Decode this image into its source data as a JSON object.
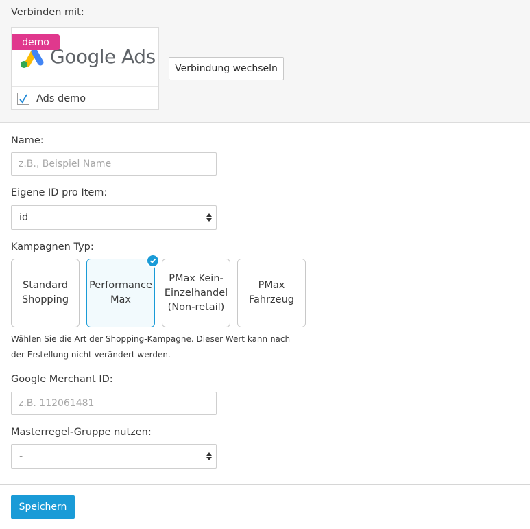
{
  "connect": {
    "label": "Verbinden mit:",
    "demo_badge": "demo",
    "provider_name": "Google Ads",
    "account_checked": true,
    "account_name": "Ads demo",
    "switch_button": "Verbindung wechseln"
  },
  "form": {
    "name": {
      "label": "Name:",
      "value": "",
      "placeholder": "z.B., Beispiel Name"
    },
    "item_id": {
      "label": "Eigene ID pro Item:",
      "value": "id"
    },
    "campaign_type": {
      "label": "Kampagnen Typ:",
      "options": [
        {
          "label": "Standard Shopping",
          "selected": false
        },
        {
          "label": "Performance Max",
          "selected": true
        },
        {
          "label": "PMax Kein-Einzelhandel (Non-retail)",
          "selected": false
        },
        {
          "label": "PMax Fahrzeug",
          "selected": false
        }
      ],
      "help": "Wählen Sie die Art der Shopping-Kampagne. Dieser Wert kann nach der Erstellung nicht verändert werden."
    },
    "merchant_id": {
      "label": "Google Merchant ID:",
      "value": "",
      "placeholder": "z.B. 112061481"
    },
    "master_rule_group": {
      "label": "Masterregel-Gruppe nutzen:",
      "value": "-"
    }
  },
  "actions": {
    "save_label": "Speichern"
  },
  "colors": {
    "accent": "#1a9bd7",
    "demo_badge": "#e0388d",
    "header_background": "#f6f6f6"
  }
}
